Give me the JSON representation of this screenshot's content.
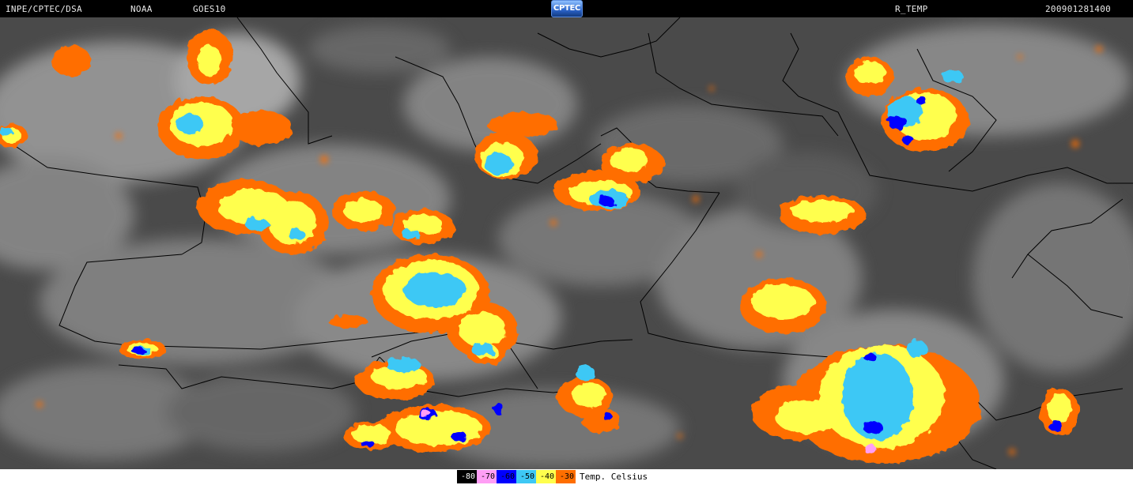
{
  "header": {
    "source": "INPE/CPTEC/DSA",
    "agency": "NOAA",
    "satellite": "GOES10",
    "logo_text": "CPTEC",
    "product": "R_TEMP",
    "timestamp": "200901281400"
  },
  "legend": {
    "unit": "Temp. Celsius",
    "entries": [
      {
        "value": "-80",
        "color": "#000000"
      },
      {
        "value": "-70",
        "color": "#ff9ef5"
      },
      {
        "value": "-60",
        "color": "#0000ff"
      },
      {
        "value": "-50",
        "color": "#3ec8f5"
      },
      {
        "value": "-40",
        "color": "#ffff4d"
      },
      {
        "value": "-30",
        "color": "#ff6e00"
      }
    ]
  },
  "map": {
    "background_gray": "#4a4a4a",
    "border_color": "#000000"
  }
}
